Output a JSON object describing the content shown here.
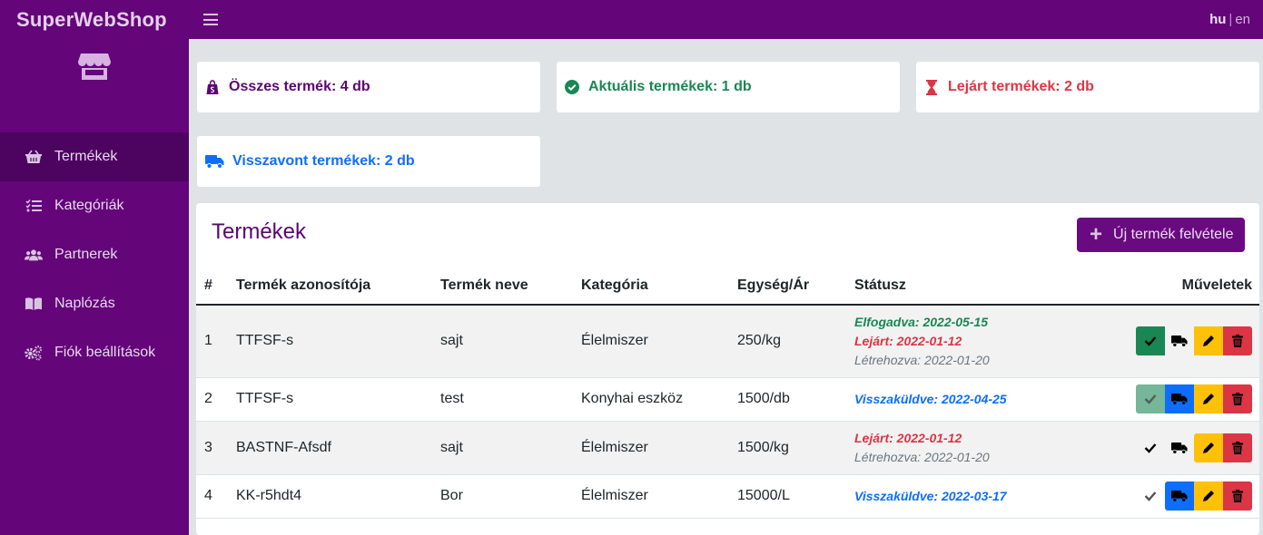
{
  "app": {
    "title": "SuperWebShop"
  },
  "header": {
    "lang_active": "hu",
    "lang_sep": "|",
    "lang_other": "en"
  },
  "sidebar": {
    "items": [
      {
        "label": "Termékek",
        "icon": "basket-icon",
        "active": true
      },
      {
        "label": "Kategóriák",
        "icon": "list-check-icon",
        "active": false
      },
      {
        "label": "Partnerek",
        "icon": "users-icon",
        "active": false
      },
      {
        "label": "Naplózás",
        "icon": "book-icon",
        "active": false
      },
      {
        "label": "Fiók beállítások",
        "icon": "gears-icon",
        "active": false
      }
    ]
  },
  "stats": {
    "total": {
      "label": "Összes termék: 4 db",
      "color": "#5b0670",
      "icon": "shopify-bag-icon"
    },
    "current": {
      "label": "Aktuális termékek: 1 db",
      "color": "#198754",
      "icon": "check-circle-icon"
    },
    "expired": {
      "label": "Lejárt termékek: 2 db",
      "color": "#dc3545",
      "icon": "hourglass-icon"
    },
    "recalled": {
      "label": "Visszavont termékek: 2 db",
      "color": "#0d6efd",
      "icon": "truck-icon"
    }
  },
  "panel": {
    "title": "Termékek",
    "new_button": "Új termék felvétele",
    "columns": [
      "#",
      "Termék azonosítója",
      "Termék neve",
      "Kategória",
      "Egység/Ár",
      "Státusz",
      "Műveletek"
    ],
    "rows": [
      {
        "num": "1",
        "id": "TTFSF-s",
        "name": "sajt",
        "category": "Élelmiszer",
        "price": "250/kg",
        "status": [
          {
            "text": "Elfogadva: 2022-05-15",
            "kind": "green"
          },
          {
            "text": "Lejárt: 2022-01-12",
            "kind": "red"
          },
          {
            "text": "Létrehozva: 2022-01-20",
            "kind": "gray"
          }
        ]
      },
      {
        "num": "2",
        "id": "TTFSF-s",
        "name": "test",
        "category": "Konyhai eszköz",
        "price": "1500/db",
        "status": [
          {
            "text": "Visszaküldve: 2022-04-25",
            "kind": "blue"
          }
        ]
      },
      {
        "num": "3",
        "id": "BASTNF-Afsdf",
        "name": "sajt",
        "category": "Élelmiszer",
        "price": "1500/kg",
        "status": [
          {
            "text": "Lejárt: 2022-01-12",
            "kind": "red"
          },
          {
            "text": "Létrehozva: 2022-01-20",
            "kind": "gray"
          }
        ]
      },
      {
        "num": "4",
        "id": "KK-r5hdt4",
        "name": "Bor",
        "category": "Élelmiszer",
        "price": "15000/L",
        "status": [
          {
            "text": "Visszaküldve: 2022-03-17",
            "kind": "blue"
          }
        ]
      }
    ]
  }
}
